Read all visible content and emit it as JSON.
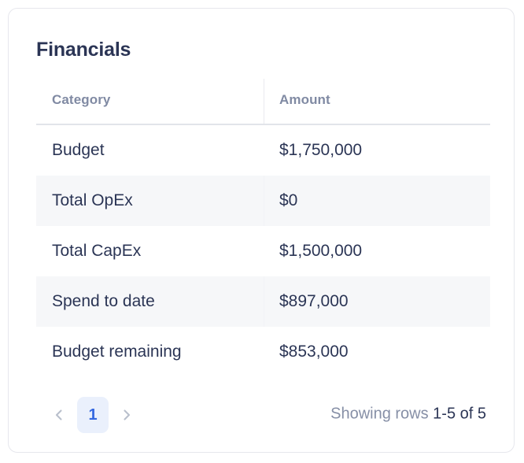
{
  "card": {
    "title": "Financials"
  },
  "table": {
    "columns": [
      {
        "key": "category",
        "label": "Category"
      },
      {
        "key": "amount",
        "label": "Amount"
      }
    ],
    "rows": [
      {
        "category": "Budget",
        "amount": "$1,750,000"
      },
      {
        "category": "Total OpEx",
        "amount": "$0"
      },
      {
        "category": "Total CapEx",
        "amount": "$1,500,000"
      },
      {
        "category": "Spend to date",
        "amount": "$897,000"
      },
      {
        "category": "Budget remaining",
        "amount": "$853,000"
      }
    ]
  },
  "pagination": {
    "prev_icon": "chevron-left-icon",
    "next_icon": "chevron-right-icon",
    "pages": [
      "1"
    ],
    "current_page": "1",
    "showing_label": "Showing rows ",
    "showing_range": "1-5 of 5"
  },
  "colors": {
    "text_primary": "#2b3555",
    "text_muted": "#868fa6",
    "header_text": "#808aa3",
    "accent": "#3568e0",
    "accent_bg": "#eaf0fc",
    "stripe": "#f6f7f9",
    "border": "#e6e7ed",
    "header_rule": "#e2e4ea"
  }
}
